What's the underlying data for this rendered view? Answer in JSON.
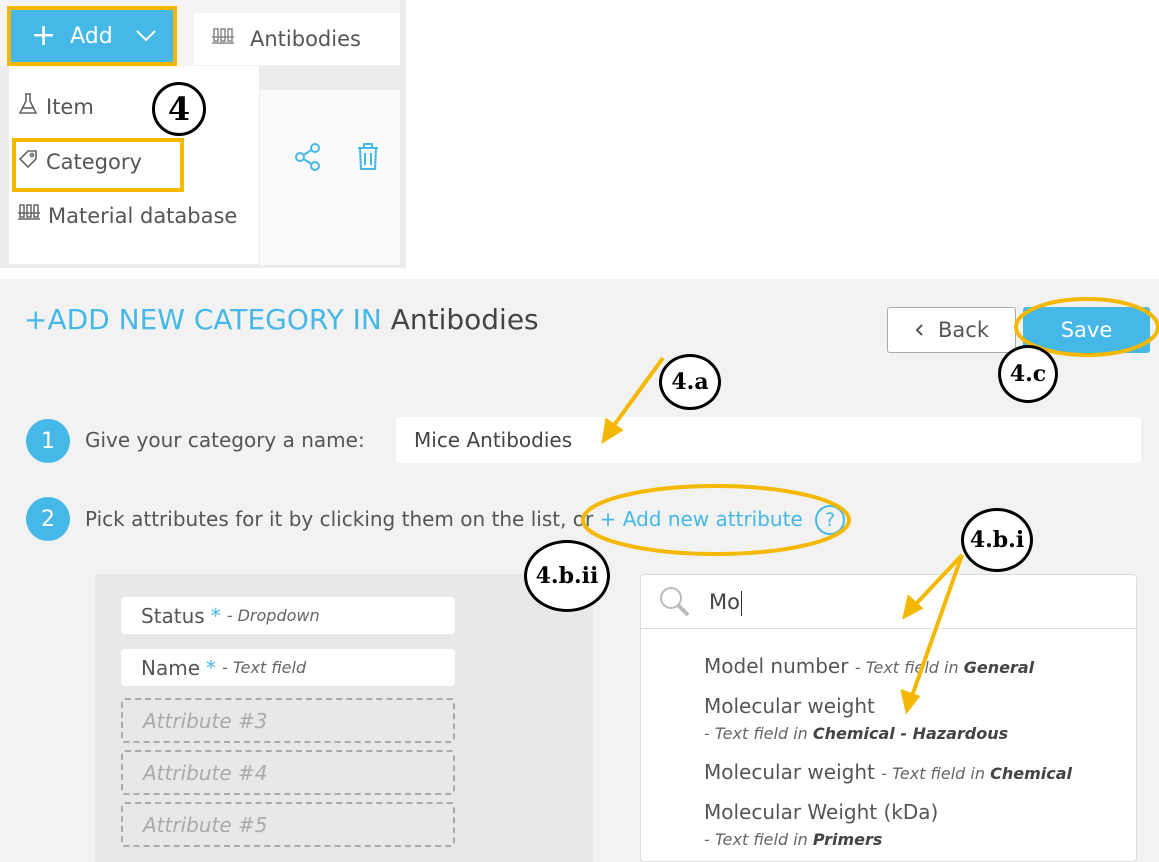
{
  "toolbar": {
    "add_label": "Add",
    "add_plus": "+",
    "tab_antibodies_label": "Antibodies"
  },
  "add_menu": {
    "items": [
      {
        "label": "Item",
        "icon": "flask-icon"
      },
      {
        "label": "Category",
        "icon": "tag-icon"
      },
      {
        "label": "Material database",
        "icon": "rack-icon"
      }
    ]
  },
  "annotations": {
    "step4": "4",
    "step4a": "4.a",
    "step4bi": "4.b.i",
    "step4bii": "4.b.ii",
    "step4c": "4.c",
    "highlight_color": "#f5b800"
  },
  "form": {
    "heading_prefix": "+ADD NEW CATEGORY IN",
    "heading_name": "Antibodies",
    "back_label": "Back",
    "save_label": "Save",
    "step1_num": "1",
    "step1_text": "Give your category a name:",
    "name_value": "Mice Antibodies",
    "step2_num": "2",
    "step2_text": "Pick attributes for it by clicking them on the list, or",
    "add_new_attribute": "+ Add new attribute",
    "help": "?"
  },
  "selected_attributes": [
    {
      "name": "Status",
      "required": "*",
      "type": "- Dropdown"
    },
    {
      "name": "Name",
      "required": "*",
      "type": "- Text field"
    }
  ],
  "empty_slots": [
    "Attribute #3",
    "Attribute #4",
    "Attribute #5"
  ],
  "search": {
    "value": "Mo",
    "results": [
      {
        "name": "Model number",
        "type_prefix": "- Text field in",
        "category": "General"
      },
      {
        "name": "Molecular weight",
        "type_prefix": "- Text field in",
        "category": "Chemical - Hazardous"
      },
      {
        "name": "Molecular weight",
        "type_prefix": "- Text field in",
        "category": "Chemical"
      },
      {
        "name": "Molecular Weight (kDa)",
        "type_prefix": "- Text field in",
        "category": "Primers"
      }
    ]
  },
  "colors": {
    "accent": "#45b8e8",
    "highlight": "#f5b800"
  }
}
